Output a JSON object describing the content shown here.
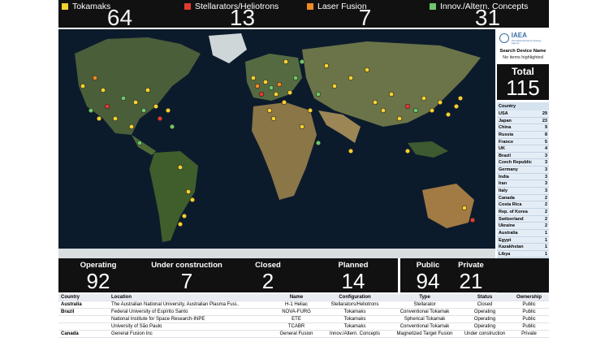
{
  "categories": [
    {
      "label": "Tokamaks",
      "count": "64",
      "color": "#f5d130"
    },
    {
      "label": "Stellarators/Heliotrons",
      "count": "13",
      "color": "#e23b2e"
    },
    {
      "label": "Laser Fusion",
      "count": "7",
      "color": "#f08a24"
    },
    {
      "label": "Innov./Altern. Concepts",
      "count": "31",
      "color": "#6fc66a"
    }
  ],
  "map": {
    "attribution": "© 2020 Mapbox © OpenStreetMap"
  },
  "sidebar": {
    "brand": "IAEA",
    "brand_sub": "International Atomic Energy Agency",
    "search_title": "Search Device Name",
    "search_status": "No items highlighted",
    "total_label": "Total",
    "total_value": "115",
    "country_header": "Country",
    "countries": [
      {
        "name": "USA",
        "count": "29"
      },
      {
        "name": "Japan",
        "count": "23"
      },
      {
        "name": "China",
        "count": "9"
      },
      {
        "name": "Russia",
        "count": "8"
      },
      {
        "name": "France",
        "count": "5"
      },
      {
        "name": "UK",
        "count": "4"
      },
      {
        "name": "Brazil",
        "count": "3"
      },
      {
        "name": "Czech Republic",
        "count": "3"
      },
      {
        "name": "Germany",
        "count": "3"
      },
      {
        "name": "India",
        "count": "3"
      },
      {
        "name": "Iran",
        "count": "3"
      },
      {
        "name": "Italy",
        "count": "3"
      },
      {
        "name": "Canada",
        "count": "2"
      },
      {
        "name": "Costa Rica",
        "count": "2"
      },
      {
        "name": "Rep. of Korea",
        "count": "2"
      },
      {
        "name": "Switzerland",
        "count": "2"
      },
      {
        "name": "Ukraine",
        "count": "2"
      },
      {
        "name": "Australia",
        "count": "1"
      },
      {
        "name": "Egypt",
        "count": "1"
      },
      {
        "name": "Kazakhstan",
        "count": "1"
      },
      {
        "name": "Libya",
        "count": "1"
      },
      {
        "name": "Pakistan",
        "count": "1"
      },
      {
        "name": "Portugal",
        "count": "1"
      },
      {
        "name": "Spain",
        "count": "1"
      },
      {
        "name": "Sweden",
        "count": "1"
      },
      {
        "name": "Thailand",
        "count": "1"
      }
    ]
  },
  "status": {
    "operating_label": "Operating",
    "operating_value": "92",
    "construction_label": "Under construction",
    "construction_value": "7",
    "closed_label": "Closed",
    "closed_value": "2",
    "planned_label": "Planned",
    "planned_value": "14",
    "public_label": "Public",
    "public_value": "94",
    "private_label": "Private",
    "private_value": "21"
  },
  "table": {
    "headers": [
      "Country",
      "Location",
      "Name",
      "Configuration",
      "Type",
      "Status",
      "Ownership"
    ],
    "rows": [
      [
        "Australia",
        "The Australian National University, Australian Plasma Fusi..",
        "H-1 Heliac",
        "Stellarators/Heliotrons",
        "Stellarator",
        "Closed",
        "Public"
      ],
      [
        "Brazil",
        "Federal University of Espírito Santo",
        "NOVA-FURG",
        "Tokamaks",
        "Conventional Tokamak",
        "Operating",
        "Public"
      ],
      [
        "",
        "National Institute for Space Research-INPE",
        "ETE",
        "Tokamaks",
        "Spherical Tokamak",
        "Operating",
        "Public"
      ],
      [
        "",
        "University of São Paulo",
        "TCABR",
        "Tokamaks",
        "Conventional Tokamak",
        "Operating",
        "Public"
      ],
      [
        "Canada",
        "General Fusion Inc",
        "General Fusion",
        "Innov./Altern. Concepts",
        "Magnetized Target Fusion",
        "Under construction",
        "Private"
      ]
    ]
  }
}
